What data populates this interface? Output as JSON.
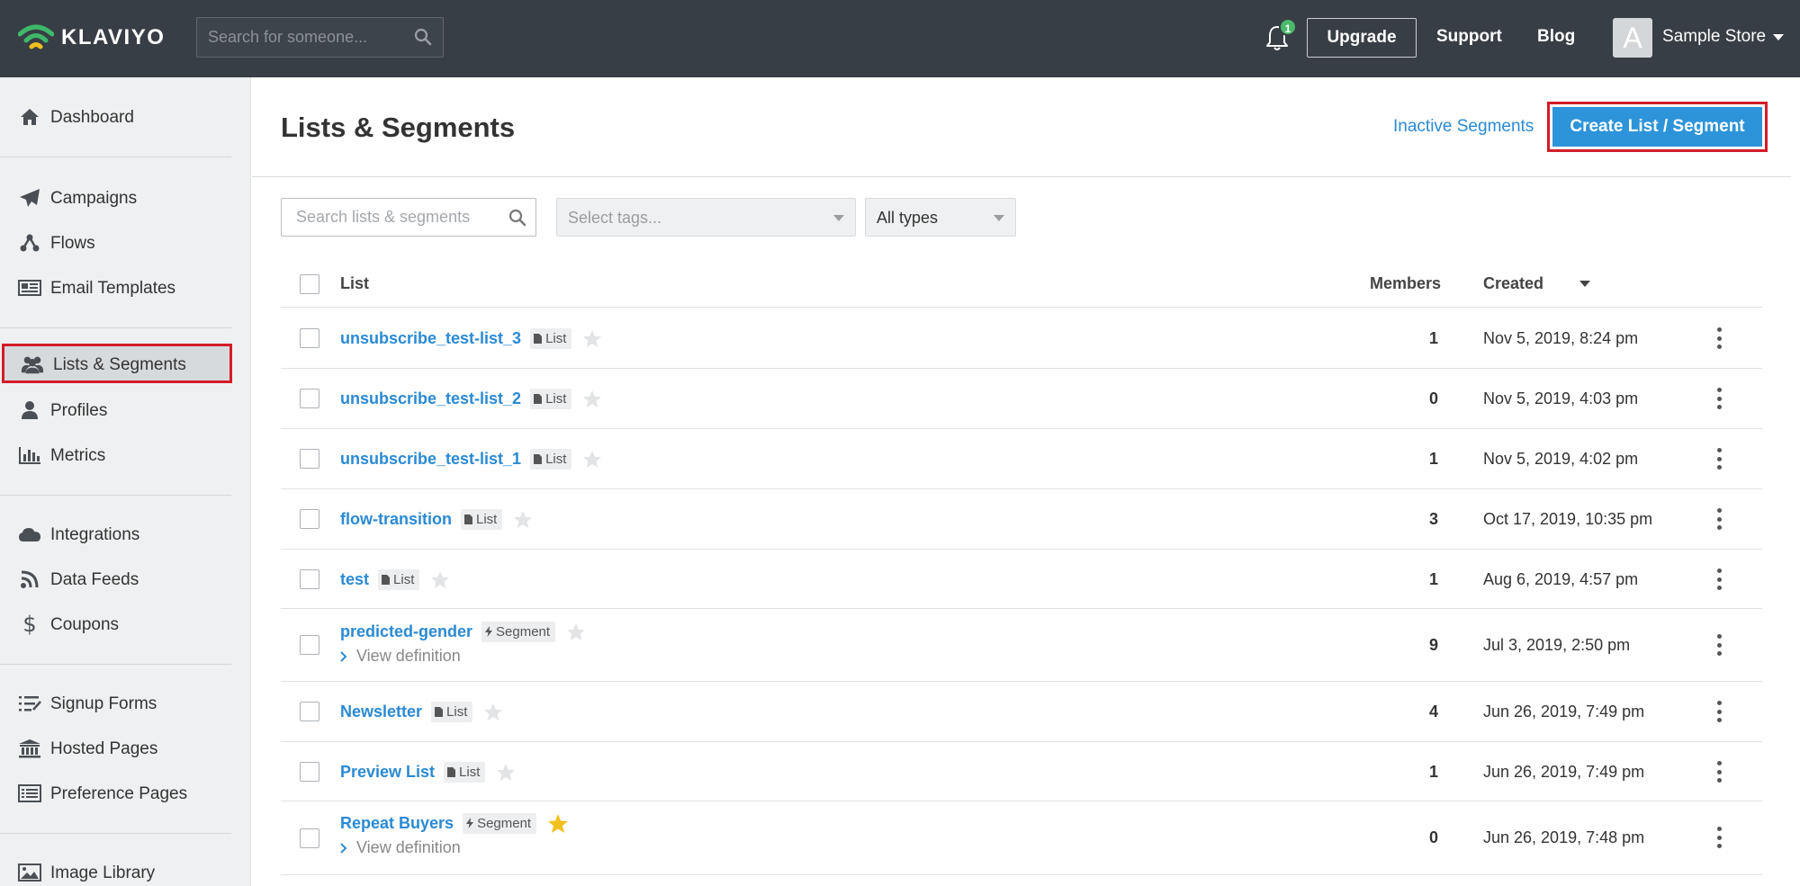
{
  "topbar": {
    "brand": "KLAVIYO",
    "search_placeholder": "Search for someone...",
    "notification_count": "1",
    "upgrade_label": "Upgrade",
    "support_label": "Support",
    "blog_label": "Blog",
    "avatar_letter": "A",
    "account_name": "Sample Store"
  },
  "sidebar": {
    "items": [
      {
        "label": "Dashboard",
        "icon": "home-icon"
      },
      {
        "label": "Campaigns",
        "icon": "paper-plane-icon"
      },
      {
        "label": "Flows",
        "icon": "flows-icon"
      },
      {
        "label": "Email Templates",
        "icon": "newspaper-icon"
      },
      {
        "label": "Lists & Segments",
        "icon": "users-icon",
        "active": true
      },
      {
        "label": "Profiles",
        "icon": "user-icon"
      },
      {
        "label": "Metrics",
        "icon": "bar-chart-icon"
      },
      {
        "label": "Integrations",
        "icon": "cloud-icon"
      },
      {
        "label": "Data Feeds",
        "icon": "rss-icon"
      },
      {
        "label": "Coupons",
        "icon": "dollar-icon"
      },
      {
        "label": "Signup Forms",
        "icon": "list-check-icon"
      },
      {
        "label": "Hosted Pages",
        "icon": "bank-icon"
      },
      {
        "label": "Preference Pages",
        "icon": "list-alt-icon"
      },
      {
        "label": "Image Library",
        "icon": "image-icon"
      }
    ]
  },
  "main": {
    "title": "Lists & Segments",
    "inactive_segments_label": "Inactive Segments",
    "create_label": "Create List / Segment",
    "search_placeholder": "Search lists & segments",
    "tags_placeholder": "Select tags...",
    "type_filter_value": "All types",
    "columns": {
      "list": "List",
      "members": "Members",
      "created": "Created"
    },
    "rows": [
      {
        "name": "unsubscribe_test-list_3",
        "type": "List",
        "members": "1",
        "created": "Nov 5, 2019, 8:24 pm",
        "starred": false
      },
      {
        "name": "unsubscribe_test-list_2",
        "type": "List",
        "members": "0",
        "created": "Nov 5, 2019, 4:03 pm",
        "starred": false
      },
      {
        "name": "unsubscribe_test-list_1",
        "type": "List",
        "members": "1",
        "created": "Nov 5, 2019, 4:02 pm",
        "starred": false
      },
      {
        "name": "flow-transition",
        "type": "List",
        "members": "3",
        "created": "Oct 17, 2019, 10:35 pm",
        "starred": false
      },
      {
        "name": "test",
        "type": "List",
        "members": "1",
        "created": "Aug 6, 2019, 4:57 pm",
        "starred": false
      },
      {
        "name": "predicted-gender",
        "type": "Segment",
        "members": "9",
        "created": "Jul 3, 2019, 2:50 pm",
        "starred": false,
        "view_definition": "View definition"
      },
      {
        "name": "Newsletter",
        "type": "List",
        "members": "4",
        "created": "Jun 26, 2019, 7:49 pm",
        "starred": false
      },
      {
        "name": "Preview List",
        "type": "List",
        "members": "1",
        "created": "Jun 26, 2019, 7:49 pm",
        "starred": false
      },
      {
        "name": "Repeat Buyers",
        "type": "Segment",
        "members": "0",
        "created": "Jun 26, 2019, 7:48 pm",
        "starred": true,
        "view_definition": "View definition"
      }
    ]
  },
  "colors": {
    "topbar_bg": "#383e45",
    "link_blue": "#2a8ad4",
    "primary_button": "#2d94d9",
    "highlight_red": "#d31d29",
    "star_active": "#f2c01e",
    "star_inactive": "#e2e4e6"
  }
}
